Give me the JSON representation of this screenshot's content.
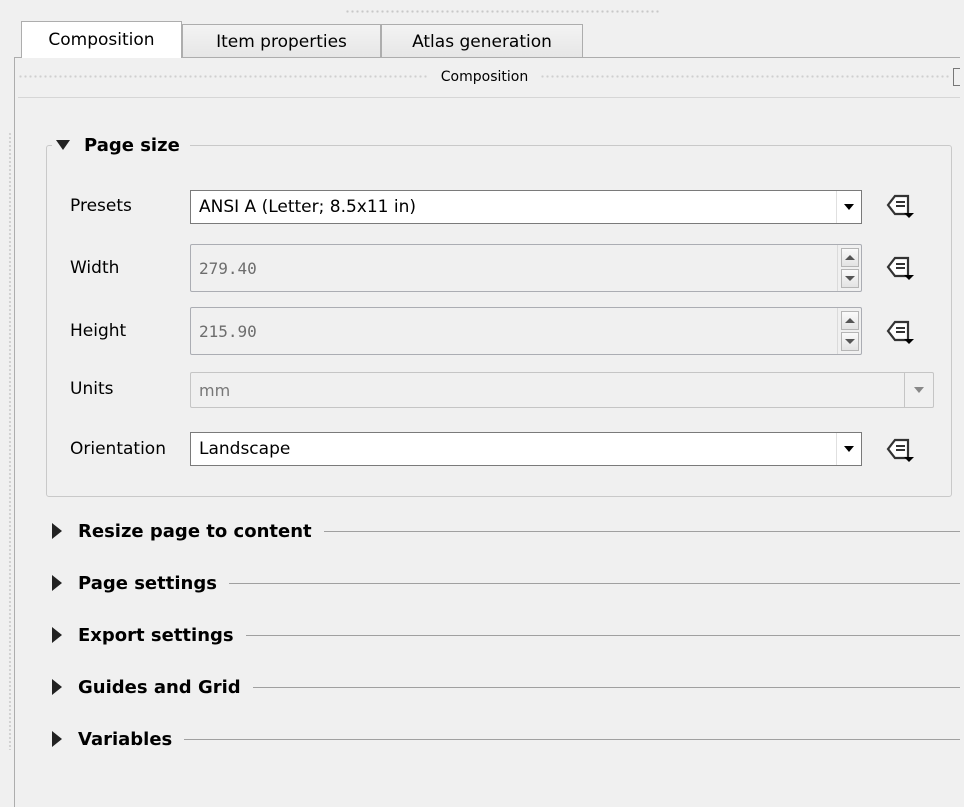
{
  "tabs": [
    {
      "label": "Composition",
      "active": true
    },
    {
      "label": "Item properties",
      "active": false
    },
    {
      "label": "Atlas generation",
      "active": false
    }
  ],
  "dock": {
    "title": "Composition"
  },
  "page_size": {
    "title": "Page size",
    "presets": {
      "label": "Presets",
      "value": "ANSI A (Letter; 8.5x11 in)"
    },
    "width": {
      "label": "Width",
      "value": "279.40"
    },
    "height": {
      "label": "Height",
      "value": "215.90"
    },
    "units": {
      "label": "Units",
      "value": "mm"
    },
    "orientation": {
      "label": "Orientation",
      "value": "Landscape"
    }
  },
  "sections": [
    {
      "label": "Resize page to content"
    },
    {
      "label": "Page settings"
    },
    {
      "label": "Export settings"
    },
    {
      "label": "Guides and Grid"
    },
    {
      "label": "Variables"
    }
  ],
  "icons": {
    "data_defined": "data-defined-override-icon"
  }
}
